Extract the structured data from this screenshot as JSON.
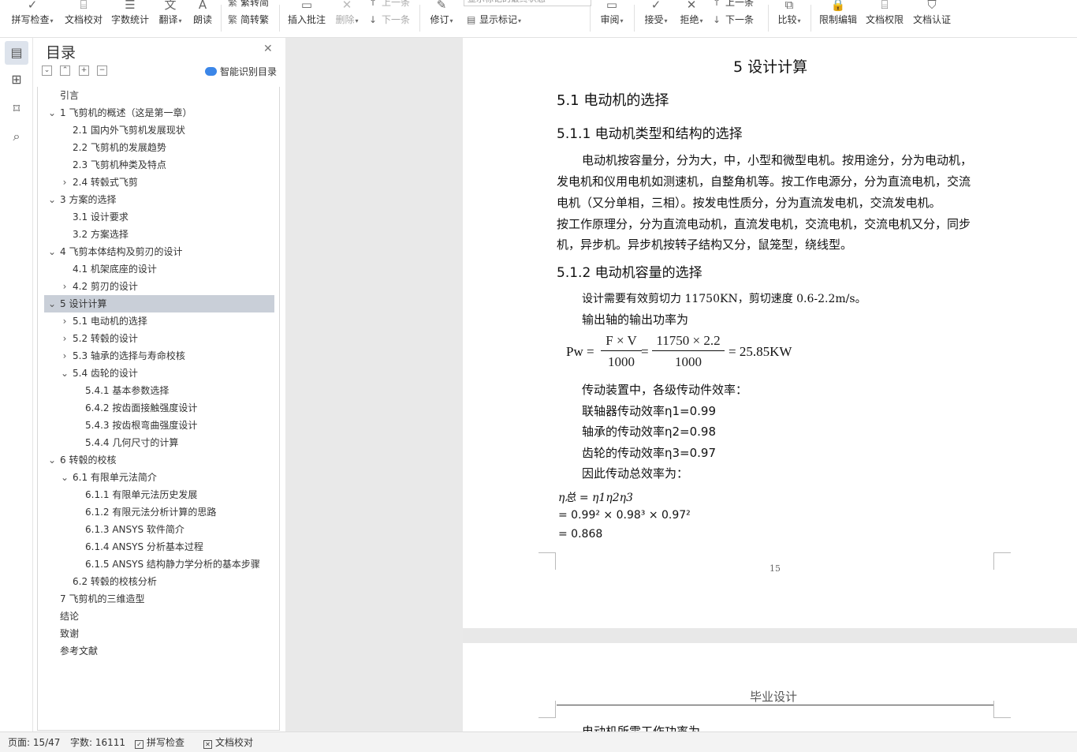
{
  "toolbar": {
    "spell_check": "拼写检查",
    "doc_proofread": "文档校对",
    "word_count": "字数统计",
    "translate": "翻译",
    "read_aloud": "朗读",
    "trad_simp_top": "繁转简",
    "simp_trad": "简转繁",
    "insert_comment": "插入批注",
    "delete": "删除",
    "prev_top": "上一条",
    "next": "下一条",
    "revise": "修订",
    "display_select": "显示标记的最终状态",
    "show_markup": "显示标记",
    "review": "审阅",
    "accept": "接受",
    "reject": "拒绝",
    "prev_rev_top": "上一条",
    "next_rev": "下一条",
    "compare": "比较",
    "restrict_edit": "限制编辑",
    "doc_permission": "文档权限",
    "doc_auth": "文档认证"
  },
  "toc": {
    "title": "目录",
    "smart_label": "智能识别目录",
    "items": [
      {
        "text": "引言",
        "level": 1,
        "arrow": ""
      },
      {
        "text": "1 飞剪机的概述（这是第一章）",
        "level": 1,
        "arrow": "open"
      },
      {
        "text": "2.1 国内外飞剪机发展现状",
        "level": 2,
        "arrow": ""
      },
      {
        "text": "2.2 飞剪机的发展趋势",
        "level": 2,
        "arrow": ""
      },
      {
        "text": "2.3 飞剪机种类及特点",
        "level": 2,
        "arrow": ""
      },
      {
        "text": "2.4  转毂式飞剪",
        "level": 2,
        "arrow": "closed"
      },
      {
        "text": "3  方案的选择",
        "level": 1,
        "arrow": "open"
      },
      {
        "text": "3.1  设计要求",
        "level": 2,
        "arrow": ""
      },
      {
        "text": "3.2  方案选择",
        "level": 2,
        "arrow": ""
      },
      {
        "text": "4 飞剪本体结构及剪刃的设计",
        "level": 1,
        "arrow": "open"
      },
      {
        "text": "4.1 机架底座的设计",
        "level": 2,
        "arrow": ""
      },
      {
        "text": "4.2 剪刃的设计",
        "level": 2,
        "arrow": "closed"
      },
      {
        "text": "5  设计计算",
        "level": 1,
        "arrow": "open",
        "selected": true
      },
      {
        "text": "5.1 电动机的选择",
        "level": 2,
        "arrow": "closed"
      },
      {
        "text": "5.2  转毂的设计",
        "level": 2,
        "arrow": "closed"
      },
      {
        "text": "5.3 轴承的选择与寿命校核",
        "level": 2,
        "arrow": "closed"
      },
      {
        "text": "5.4  齿轮的设计",
        "level": 2,
        "arrow": "open"
      },
      {
        "text": "5.4.1  基本参数选择",
        "level": 3,
        "arrow": ""
      },
      {
        "text": "6.4.2  按齿面接触强度设计",
        "level": 3,
        "arrow": ""
      },
      {
        "text": "5.4.3 按齿根弯曲强度设计",
        "level": 3,
        "arrow": ""
      },
      {
        "text": "5.4.4  几何尺寸的计算",
        "level": 3,
        "arrow": ""
      },
      {
        "text": "6  转毂的校核",
        "level": 1,
        "arrow": "open"
      },
      {
        "text": "6.1 有限单元法简介",
        "level": 2,
        "arrow": "open"
      },
      {
        "text": "6.1.1  有限单元法历史发展",
        "level": 3,
        "arrow": ""
      },
      {
        "text": "6.1.2 有限元法分析计算的思路",
        "level": 3,
        "arrow": ""
      },
      {
        "text": "6.1.3    ANSYS 软件简介",
        "level": 3,
        "arrow": ""
      },
      {
        "text": "6.1.4    ANSYS 分析基本过程",
        "level": 3,
        "arrow": ""
      },
      {
        "text": "6.1.5 ANSYS 结构静力学分析的基本步骤",
        "level": 3,
        "arrow": ""
      },
      {
        "text": "6.2  转毂的校核分析",
        "level": 2,
        "arrow": ""
      },
      {
        "text": "7 飞剪机的三维造型",
        "level": 1,
        "arrow": ""
      },
      {
        "text": "结论",
        "level": 1,
        "arrow": ""
      },
      {
        "text": "致谢",
        "level": 1,
        "arrow": ""
      },
      {
        "text": "参考文献",
        "level": 1,
        "arrow": ""
      }
    ]
  },
  "doc": {
    "chapter_title": "5  设计计算",
    "sec_5_1": "5.1 电动机的选择",
    "sec_5_1_1": "5.1.1 电动机类型和结构的选择",
    "para1": [
      "电动机按容量分，分为大，中，小型和微型电机。按用途分，分为电动机，",
      "发电机和仪用电机如测速机，自整角机等。按工作电源分，分为直流电机，交流",
      "电机（又分单相，三相）。按发电性质分，分为直流发电机，交流发电机。",
      "按工作原理分，分为直流电动机，直流发电机，交流电机，交流电机又分，同步",
      "机，异步机。异步机按转子结构又分，鼠笼型，绕线型。"
    ],
    "sec_5_1_2": "5.1.2  电动机容量的选择",
    "line_force": "设计需要有效剪切力 11750KN，剪切速度 0.6-2.2m/s。",
    "line_output": "输出轴的输出功率为",
    "formula": {
      "lhs": "Pw =",
      "f1_num": "F × V",
      "f1_den": "1000",
      "eq": "=",
      "f2_num": "11750 × 2.2",
      "f2_den": "1000",
      "result": "= 25.85KW"
    },
    "eff_lines": [
      "传动装置中，各级传动件效率：",
      "联轴器传动效率η1=0.99",
      "轴承的传动效率η2=0.98",
      "齿轮的传动效率η3=0.97",
      "因此传动总效率为："
    ],
    "total_formula": {
      "line1": "η总 = η1η2η3",
      "line2": "= 0.99² × 0.98³ × 0.97²",
      "line3": "= 0.868"
    },
    "page_number": "15",
    "page2_header": "毕业设计",
    "page2_line": "电动机所需工作功率为"
  },
  "status": {
    "page": "页面: 15/47",
    "words": "字数: 16111",
    "spell_check": "拼写检查",
    "doc_proofread": "文档校对"
  }
}
